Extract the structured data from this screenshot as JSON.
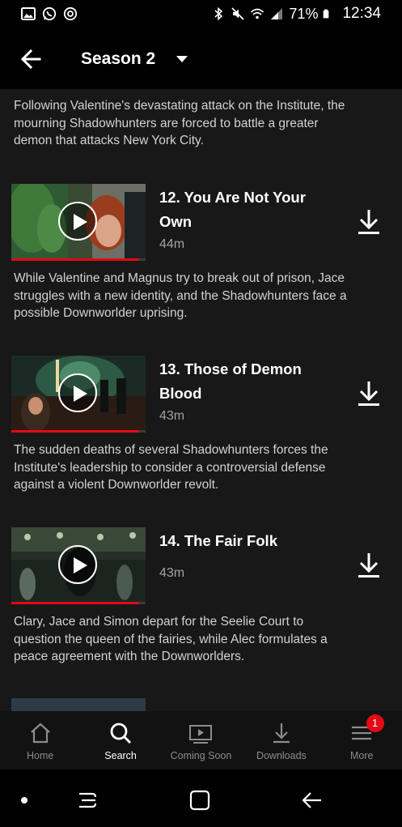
{
  "status_bar": {
    "battery_percent": "71%",
    "time": "12:34",
    "left_icons": [
      "gallery-icon",
      "whatsapp-icon",
      "sync-icon"
    ],
    "right_icons": [
      "bluetooth-icon",
      "mute-icon",
      "wifi-icon",
      "signal-icon",
      "battery-icon"
    ]
  },
  "header": {
    "season_label": "Season 2",
    "back_icon": "arrow-left-icon",
    "dropdown_icon": "caret-down-icon"
  },
  "intro": {
    "description": "Following Valentine's devastating attack on the Institute, the mourning Shadowhunters are forced to battle a greater demon that attacks New York City."
  },
  "episodes": [
    {
      "title": "12. You Are Not Your Own",
      "duration": "44m",
      "description": "While Valentine and Magnus try to break out of prison, Jace struggles with a new identity, and the Shadowhunters face a possible Downworlder uprising.",
      "watched_fraction": 0.95
    },
    {
      "title": "13. Those of Demon Blood",
      "duration": "43m",
      "description": "The sudden deaths of several Shadowhunters forces the Institute's leadership to consider a controversial defense against a violent Downworlder revolt.",
      "watched_fraction": 0.95
    },
    {
      "title": "14. The Fair Folk",
      "duration": "43m",
      "description": "Clary, Jace and Simon depart for the Seelie Court to question the queen of the fairies, while Alec formulates a peace agreement with the Downworlders.",
      "watched_fraction": 0.95
    }
  ],
  "bottom_nav": {
    "items": [
      {
        "label": "Home",
        "icon": "home-icon",
        "active": false
      },
      {
        "label": "Search",
        "icon": "search-icon",
        "active": true
      },
      {
        "label": "Coming Soon",
        "icon": "play-screen-icon",
        "active": false
      },
      {
        "label": "Downloads",
        "icon": "download-icon",
        "active": false
      },
      {
        "label": "More",
        "icon": "menu-icon",
        "active": false,
        "badge": "1"
      }
    ]
  },
  "system_nav": {
    "buttons": [
      "dot-icon",
      "recents-icon",
      "home-square-icon",
      "back-arrow-icon"
    ]
  },
  "colors": {
    "background": "#181818",
    "accent": "#e50914",
    "text_secondary": "#a3a3a3"
  }
}
